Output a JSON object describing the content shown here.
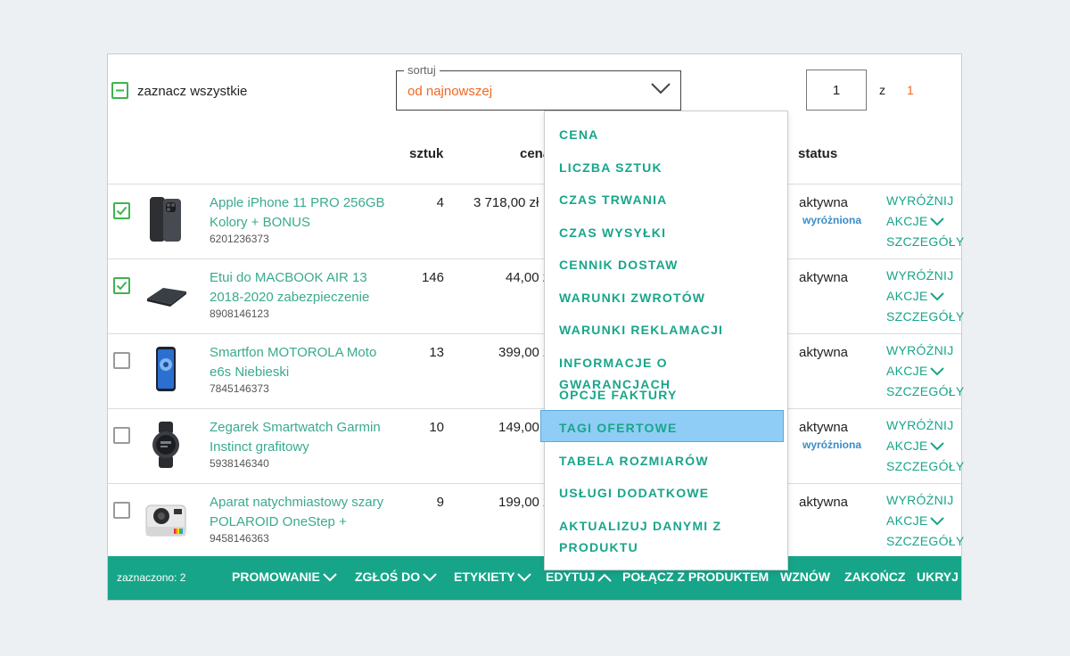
{
  "toolbar": {
    "select_all_label": "zaznacz wszystkie",
    "sort_caption": "sortuj",
    "sort_value": "od najnowszej",
    "page_current": "1",
    "page_of": "z",
    "page_total": "1"
  },
  "table": {
    "headers": {
      "qty": "sztuk",
      "price": "cena",
      "status": "status"
    },
    "actions": {
      "feature": "WYRÓŻNIJ",
      "actions": "AKCJE",
      "details": "SZCZEGÓŁY"
    },
    "rows": [
      {
        "checked": true,
        "name": "Apple iPhone 11 PRO 256GB Kolory + BONUS",
        "id": "6201236373",
        "qty": "4",
        "price": "3 718,00 zł",
        "status": "aktywna",
        "badge": "wyróżniona"
      },
      {
        "checked": true,
        "name": "Etui do MACBOOK AIR 13 2018-2020 zabezpieczenie",
        "id": "8908146123",
        "qty": "146",
        "price": "44,00 zł",
        "status": "aktywna",
        "badge": ""
      },
      {
        "checked": false,
        "name": "Smartfon MOTOROLA Moto e6s Niebieski",
        "id": "7845146373",
        "qty": "13",
        "price": "399,00 zł",
        "status": "aktywna",
        "badge": ""
      },
      {
        "checked": false,
        "name": "Zegarek Smartwatch Garmin Instinct grafitowy",
        "id": "5938146340",
        "qty": "10",
        "price": "149,00 zł",
        "status": "aktywna",
        "badge": "wyróżniona"
      },
      {
        "checked": false,
        "name": "Aparat natychmiastowy szary POLAROID OneStep +",
        "id": "9458146363",
        "qty": "9",
        "price": "199,00 zł",
        "status": "aktywna",
        "badge": ""
      }
    ]
  },
  "bottom_bar": {
    "selected": "zaznaczono: 2",
    "promote": "PROMOWANIE",
    "report": "ZGŁOŚ DO",
    "labels": "ETYKIETY",
    "edit": "EDYTUJ",
    "link": "POŁĄCZ Z PRODUKTEM",
    "resume": "WZNÓW",
    "end": "ZAKOŃCZ",
    "hide": "UKRYJ"
  },
  "sort_menu": {
    "items": [
      "CENA",
      "LICZBA SZTUK",
      "CZAS TRWANIA",
      "CZAS WYSYŁKI",
      "CENNIK DOSTAW",
      "WARUNKI ZWROTÓW",
      "WARUNKI REKLAMACJI",
      "INFORMACJE O GWARANCJACH",
      "OPCJE FAKTURY",
      "TAGI OFERTOWE",
      "TABELA ROZMIARÓW",
      "USŁUGI DODATKOWE",
      "AKTUALIZUJ DANYMI Z PRODUKTU"
    ],
    "highlighted": "TAGI OFERTOWE"
  },
  "colors": {
    "accent": "#19a58a",
    "link": "#3aaa8e",
    "sort_value": "#f26722",
    "badge": "#3a8cc8",
    "highlight": "#8fcdf6"
  },
  "icons": {
    "check": "check-icon",
    "minus": "minus-icon",
    "chevron_down": "chevron-down-icon",
    "chevron_up": "chevron-up-icon"
  }
}
